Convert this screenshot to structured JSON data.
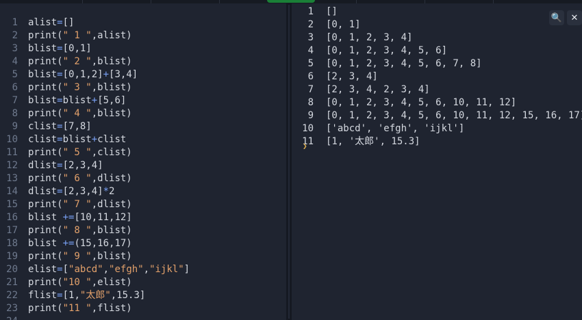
{
  "editor": {
    "lines": [
      {
        "n": "1",
        "tokens": [
          {
            "t": "alist",
            "c": "fn"
          },
          {
            "t": "=",
            "c": "op"
          },
          {
            "t": "[]",
            "c": "fn"
          }
        ]
      },
      {
        "n": "2",
        "tokens": [
          {
            "t": "print(",
            "c": "fn"
          },
          {
            "t": "\" 1 \"",
            "c": "str"
          },
          {
            "t": ",alist)",
            "c": "fn"
          }
        ]
      },
      {
        "n": "3",
        "tokens": [
          {
            "t": "blist",
            "c": "fn"
          },
          {
            "t": "=",
            "c": "op"
          },
          {
            "t": "[0,1]",
            "c": "fn"
          }
        ]
      },
      {
        "n": "4",
        "tokens": [
          {
            "t": "print(",
            "c": "fn"
          },
          {
            "t": "\" 2 \"",
            "c": "str"
          },
          {
            "t": ",blist)",
            "c": "fn"
          }
        ]
      },
      {
        "n": "5",
        "tokens": [
          {
            "t": "blist",
            "c": "fn"
          },
          {
            "t": "=",
            "c": "op"
          },
          {
            "t": "[0,1,2]",
            "c": "fn"
          },
          {
            "t": "+",
            "c": "op"
          },
          {
            "t": "[3,4]",
            "c": "fn"
          }
        ]
      },
      {
        "n": "6",
        "tokens": [
          {
            "t": "print(",
            "c": "fn"
          },
          {
            "t": "\" 3 \"",
            "c": "str"
          },
          {
            "t": ",blist)",
            "c": "fn"
          }
        ]
      },
      {
        "n": "7",
        "tokens": [
          {
            "t": "blist",
            "c": "fn"
          },
          {
            "t": "=",
            "c": "op"
          },
          {
            "t": "blist",
            "c": "fn"
          },
          {
            "t": "+",
            "c": "op"
          },
          {
            "t": "[5,6]",
            "c": "fn"
          }
        ]
      },
      {
        "n": "8",
        "tokens": [
          {
            "t": "print(",
            "c": "fn"
          },
          {
            "t": "\" 4 \"",
            "c": "str"
          },
          {
            "t": ",blist)",
            "c": "fn"
          }
        ]
      },
      {
        "n": "9",
        "tokens": [
          {
            "t": "clist",
            "c": "fn"
          },
          {
            "t": "=",
            "c": "op"
          },
          {
            "t": "[7,8]",
            "c": "fn"
          }
        ]
      },
      {
        "n": "10",
        "tokens": [
          {
            "t": "clist",
            "c": "fn"
          },
          {
            "t": "=",
            "c": "op"
          },
          {
            "t": "blist",
            "c": "fn"
          },
          {
            "t": "+",
            "c": "op"
          },
          {
            "t": "clist",
            "c": "fn"
          }
        ]
      },
      {
        "n": "11",
        "tokens": [
          {
            "t": "print(",
            "c": "fn"
          },
          {
            "t": "\" 5 \"",
            "c": "str"
          },
          {
            "t": ",clist)",
            "c": "fn"
          }
        ]
      },
      {
        "n": "12",
        "tokens": [
          {
            "t": "dlist",
            "c": "fn"
          },
          {
            "t": "=",
            "c": "op"
          },
          {
            "t": "[2,3,4]",
            "c": "fn"
          }
        ]
      },
      {
        "n": "13",
        "tokens": [
          {
            "t": "print(",
            "c": "fn"
          },
          {
            "t": "\" 6 \"",
            "c": "str"
          },
          {
            "t": ",dlist)",
            "c": "fn"
          }
        ]
      },
      {
        "n": "14",
        "tokens": [
          {
            "t": "dlist",
            "c": "fn"
          },
          {
            "t": "=",
            "c": "op"
          },
          {
            "t": "[2,3,4]",
            "c": "fn"
          },
          {
            "t": "*",
            "c": "op"
          },
          {
            "t": "2",
            "c": "fn"
          }
        ]
      },
      {
        "n": "15",
        "tokens": [
          {
            "t": "print(",
            "c": "fn"
          },
          {
            "t": "\" 7 \"",
            "c": "str"
          },
          {
            "t": ",dlist)",
            "c": "fn"
          }
        ]
      },
      {
        "n": "16",
        "tokens": [
          {
            "t": "blist ",
            "c": "fn"
          },
          {
            "t": "+=",
            "c": "op"
          },
          {
            "t": "[10,11,12]",
            "c": "fn"
          }
        ]
      },
      {
        "n": "17",
        "tokens": [
          {
            "t": "print(",
            "c": "fn"
          },
          {
            "t": "\" 8 \"",
            "c": "str"
          },
          {
            "t": ",blist)",
            "c": "fn"
          }
        ]
      },
      {
        "n": "18",
        "tokens": [
          {
            "t": "blist ",
            "c": "fn"
          },
          {
            "t": "+=",
            "c": "op"
          },
          {
            "t": "(15,16,17)",
            "c": "fn"
          }
        ]
      },
      {
        "n": "19",
        "tokens": [
          {
            "t": "print(",
            "c": "fn"
          },
          {
            "t": "\" 9 \"",
            "c": "str"
          },
          {
            "t": ",blist)",
            "c": "fn"
          }
        ]
      },
      {
        "n": "20",
        "tokens": [
          {
            "t": "elist",
            "c": "fn"
          },
          {
            "t": "=",
            "c": "op"
          },
          {
            "t": "[",
            "c": "fn"
          },
          {
            "t": "\"abcd\"",
            "c": "str"
          },
          {
            "t": ",",
            "c": "fn"
          },
          {
            "t": "\"efgh\"",
            "c": "str"
          },
          {
            "t": ",",
            "c": "fn"
          },
          {
            "t": "\"ijkl\"",
            "c": "str"
          },
          {
            "t": "]",
            "c": "fn"
          }
        ]
      },
      {
        "n": "21",
        "tokens": [
          {
            "t": "print(",
            "c": "fn"
          },
          {
            "t": "\"10 \"",
            "c": "str"
          },
          {
            "t": ",elist)",
            "c": "fn"
          }
        ]
      },
      {
        "n": "22",
        "tokens": [
          {
            "t": "flist",
            "c": "fn"
          },
          {
            "t": "=",
            "c": "op"
          },
          {
            "t": "[1,",
            "c": "fn"
          },
          {
            "t": "\"太郎\"",
            "c": "str"
          },
          {
            "t": ",15.3]",
            "c": "fn"
          }
        ]
      },
      {
        "n": "23",
        "tokens": [
          {
            "t": "print(",
            "c": "fn"
          },
          {
            "t": "\"11 \"",
            "c": "str"
          },
          {
            "t": ",flist)",
            "c": "fn"
          }
        ]
      },
      {
        "n": "24",
        "tokens": []
      }
    ]
  },
  "console": {
    "lines": [
      {
        "n": "1",
        "text": "[]"
      },
      {
        "n": "2",
        "text": "[0, 1]"
      },
      {
        "n": "3",
        "text": "[0, 1, 2, 3, 4]"
      },
      {
        "n": "4",
        "text": "[0, 1, 2, 3, 4, 5, 6]"
      },
      {
        "n": "5",
        "text": "[0, 1, 2, 3, 4, 5, 6, 7, 8]"
      },
      {
        "n": "6",
        "text": "[2, 3, 4]"
      },
      {
        "n": "7",
        "text": "[2, 3, 4, 2, 3, 4]"
      },
      {
        "n": "8",
        "text": "[0, 1, 2, 3, 4, 5, 6, 10, 11, 12]"
      },
      {
        "n": "9",
        "text": "[0, 1, 2, 3, 4, 5, 6, 10, 11, 12, 15, 16, 17]"
      },
      {
        "n": "10",
        "text": "['abcd', 'efgh', 'ijkl']"
      },
      {
        "n": "11",
        "text": "[1, '太郎', 15.3]"
      }
    ],
    "prompt_glyph": "❯",
    "tools": {
      "search": "🔍",
      "close": "✕"
    }
  }
}
